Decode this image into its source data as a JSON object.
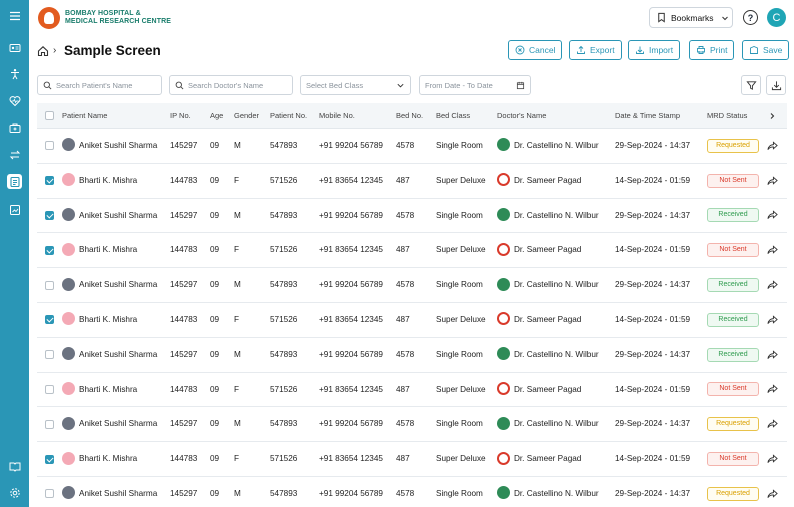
{
  "brand": {
    "line1": "BOMBAY HOSPITAL &",
    "line2": "MEDICAL RESEARCH CENTRE"
  },
  "header": {
    "bookmarks_label": "Bookmarks",
    "help_glyph": "?",
    "avatar_initial": "C"
  },
  "page": {
    "title": "Sample Screen"
  },
  "actions": {
    "cancel": "Cancel",
    "export": "Export",
    "import": "Import",
    "print": "Print",
    "save": "Save"
  },
  "filters": {
    "patient_placeholder": "Search Patient's Name",
    "doctor_placeholder": "Search Doctor's Name",
    "bed_class": "Select Bed Class",
    "date_range": "From Date - To Date"
  },
  "columns": [
    "Patient Name",
    "IP No.",
    "Age",
    "Gender",
    "Patient No.",
    "Mobile No.",
    "Bed No.",
    "Bed Class",
    "Doctor's Name",
    "Date & Time Stamp",
    "MRD Status"
  ],
  "rows": [
    {
      "checked": false,
      "gender_type": "m",
      "name": "Aniket Sushil Sharma",
      "ip": "145297",
      "age": "09",
      "gender": "M",
      "pno": "547893",
      "mobile": "+91 99204 56789",
      "bed": "4578",
      "bedclass": "Single Room",
      "doc_type": "a",
      "doctor": "Dr. Castellino N. Wilbur",
      "date": "29-Sep-2024 - 14:37",
      "status": "Requested",
      "status_type": "req"
    },
    {
      "checked": true,
      "gender_type": "f",
      "name": "Bharti K. Mishra",
      "ip": "144783",
      "age": "09",
      "gender": "F",
      "pno": "571526",
      "mobile": "+91 83654 12345",
      "bed": "487",
      "bedclass": "Super Deluxe",
      "doc_type": "b",
      "doctor": "Dr. Sameer Pagad",
      "date": "14-Sep-2024 - 01:59",
      "status": "Not Sent",
      "status_type": "not"
    },
    {
      "checked": true,
      "gender_type": "m",
      "name": "Aniket Sushil Sharma",
      "ip": "145297",
      "age": "09",
      "gender": "M",
      "pno": "547893",
      "mobile": "+91 99204 56789",
      "bed": "4578",
      "bedclass": "Single Room",
      "doc_type": "a",
      "doctor": "Dr. Castellino N. Wilbur",
      "date": "29-Sep-2024 - 14:37",
      "status": "Received",
      "status_type": "rec"
    },
    {
      "checked": true,
      "gender_type": "f",
      "name": "Bharti K. Mishra",
      "ip": "144783",
      "age": "09",
      "gender": "F",
      "pno": "571526",
      "mobile": "+91 83654 12345",
      "bed": "487",
      "bedclass": "Super Deluxe",
      "doc_type": "b",
      "doctor": "Dr. Sameer Pagad",
      "date": "14-Sep-2024 - 01:59",
      "status": "Not Sent",
      "status_type": "not"
    },
    {
      "checked": false,
      "gender_type": "m",
      "name": "Aniket Sushil Sharma",
      "ip": "145297",
      "age": "09",
      "gender": "M",
      "pno": "547893",
      "mobile": "+91 99204 56789",
      "bed": "4578",
      "bedclass": "Single Room",
      "doc_type": "a",
      "doctor": "Dr. Castellino N. Wilbur",
      "date": "29-Sep-2024 - 14:37",
      "status": "Received",
      "status_type": "rec"
    },
    {
      "checked": true,
      "gender_type": "f",
      "name": "Bharti K. Mishra",
      "ip": "144783",
      "age": "09",
      "gender": "F",
      "pno": "571526",
      "mobile": "+91 83654 12345",
      "bed": "487",
      "bedclass": "Super Deluxe",
      "doc_type": "b",
      "doctor": "Dr. Sameer Pagad",
      "date": "14-Sep-2024 - 01:59",
      "status": "Received",
      "status_type": "rec"
    },
    {
      "checked": false,
      "gender_type": "m",
      "name": "Aniket Sushil Sharma",
      "ip": "145297",
      "age": "09",
      "gender": "M",
      "pno": "547893",
      "mobile": "+91 99204 56789",
      "bed": "4578",
      "bedclass": "Single Room",
      "doc_type": "a",
      "doctor": "Dr. Castellino N. Wilbur",
      "date": "29-Sep-2024 - 14:37",
      "status": "Received",
      "status_type": "rec"
    },
    {
      "checked": false,
      "gender_type": "f",
      "name": "Bharti K. Mishra",
      "ip": "144783",
      "age": "09",
      "gender": "F",
      "pno": "571526",
      "mobile": "+91 83654 12345",
      "bed": "487",
      "bedclass": "Super Deluxe",
      "doc_type": "b",
      "doctor": "Dr. Sameer Pagad",
      "date": "14-Sep-2024 - 01:59",
      "status": "Not Sent",
      "status_type": "not"
    },
    {
      "checked": false,
      "gender_type": "m",
      "name": "Aniket Sushil Sharma",
      "ip": "145297",
      "age": "09",
      "gender": "M",
      "pno": "547893",
      "mobile": "+91 99204 56789",
      "bed": "4578",
      "bedclass": "Single Room",
      "doc_type": "a",
      "doctor": "Dr. Castellino N. Wilbur",
      "date": "29-Sep-2024 - 14:37",
      "status": "Requested",
      "status_type": "req"
    },
    {
      "checked": true,
      "gender_type": "f",
      "name": "Bharti K. Mishra",
      "ip": "144783",
      "age": "09",
      "gender": "F",
      "pno": "571526",
      "mobile": "+91 83654 12345",
      "bed": "487",
      "bedclass": "Super Deluxe",
      "doc_type": "b",
      "doctor": "Dr. Sameer Pagad",
      "date": "14-Sep-2024 - 01:59",
      "status": "Not Sent",
      "status_type": "not"
    },
    {
      "checked": false,
      "gender_type": "m",
      "name": "Aniket Sushil Sharma",
      "ip": "145297",
      "age": "09",
      "gender": "M",
      "pno": "547893",
      "mobile": "+91 99204 56789",
      "bed": "4578",
      "bedclass": "Single Room",
      "doc_type": "a",
      "doctor": "Dr. Castellino N. Wilbur",
      "date": "29-Sep-2024 - 14:37",
      "status": "Requested",
      "status_type": "req"
    }
  ],
  "colors": {
    "accent": "#2a96b6",
    "requested": "#d9a000",
    "not_sent": "#d93a2b",
    "received": "#2e9b4e"
  }
}
